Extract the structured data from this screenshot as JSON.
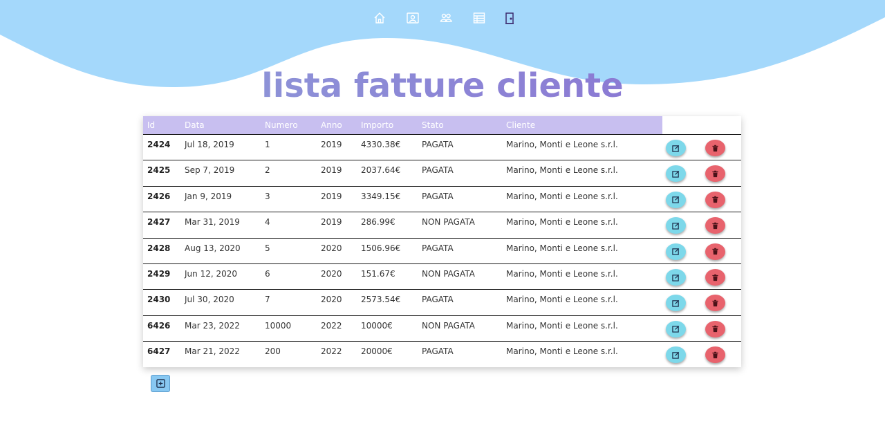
{
  "colors": {
    "header_bg": "#a4d8fb",
    "title_gradient": [
      "#8fa3d9",
      "#8a6ad0"
    ],
    "table_header_bg": "#c8bff0",
    "edit_button": "#7dd8ea",
    "delete_button": "#e8636d",
    "add_button": "#88c8f2"
  },
  "nav": {
    "items": [
      {
        "icon": "home-icon"
      },
      {
        "icon": "user-card-icon"
      },
      {
        "icon": "users-icon"
      },
      {
        "icon": "table-icon"
      },
      {
        "icon": "door-logout-icon"
      }
    ]
  },
  "page_title": "lista fatture cliente",
  "table": {
    "headers": [
      "Id",
      "Data",
      "Numero",
      "Anno",
      "Importo",
      "Stato",
      "Cliente"
    ],
    "rows": [
      {
        "id": "2424",
        "data": "Jul 18, 2019",
        "numero": "1",
        "anno": "2019",
        "importo": "4330.38€",
        "stato": "PAGATA",
        "cliente": "Marino, Monti e Leone s.r.l."
      },
      {
        "id": "2425",
        "data": "Sep 7, 2019",
        "numero": "2",
        "anno": "2019",
        "importo": "2037.64€",
        "stato": "PAGATA",
        "cliente": "Marino, Monti e Leone s.r.l."
      },
      {
        "id": "2426",
        "data": "Jan 9, 2019",
        "numero": "3",
        "anno": "2019",
        "importo": "3349.15€",
        "stato": "PAGATA",
        "cliente": "Marino, Monti e Leone s.r.l."
      },
      {
        "id": "2427",
        "data": "Mar 31, 2019",
        "numero": "4",
        "anno": "2019",
        "importo": "286.99€",
        "stato": "NON PAGATA",
        "cliente": "Marino, Monti e Leone s.r.l."
      },
      {
        "id": "2428",
        "data": "Aug 13, 2020",
        "numero": "5",
        "anno": "2020",
        "importo": "1506.96€",
        "stato": "PAGATA",
        "cliente": "Marino, Monti e Leone s.r.l."
      },
      {
        "id": "2429",
        "data": "Jun 12, 2020",
        "numero": "6",
        "anno": "2020",
        "importo": "151.67€",
        "stato": "NON PAGATA",
        "cliente": "Marino, Monti e Leone s.r.l."
      },
      {
        "id": "2430",
        "data": "Jul 30, 2020",
        "numero": "7",
        "anno": "2020",
        "importo": "2573.54€",
        "stato": "PAGATA",
        "cliente": "Marino, Monti e Leone s.r.l."
      },
      {
        "id": "6426",
        "data": "Mar 23, 2022",
        "numero": "10000",
        "anno": "2022",
        "importo": "10000€",
        "stato": "NON PAGATA",
        "cliente": "Marino, Monti e Leone s.r.l."
      },
      {
        "id": "6427",
        "data": "Mar 21, 2022",
        "numero": "200",
        "anno": "2022",
        "importo": "20000€",
        "stato": "PAGATA",
        "cliente": "Marino, Monti e Leone s.r.l."
      }
    ],
    "row_actions": {
      "edit_icon": "edit-icon",
      "delete_icon": "trash-icon"
    }
  },
  "add_button": {
    "icon": "plus-square-icon"
  }
}
